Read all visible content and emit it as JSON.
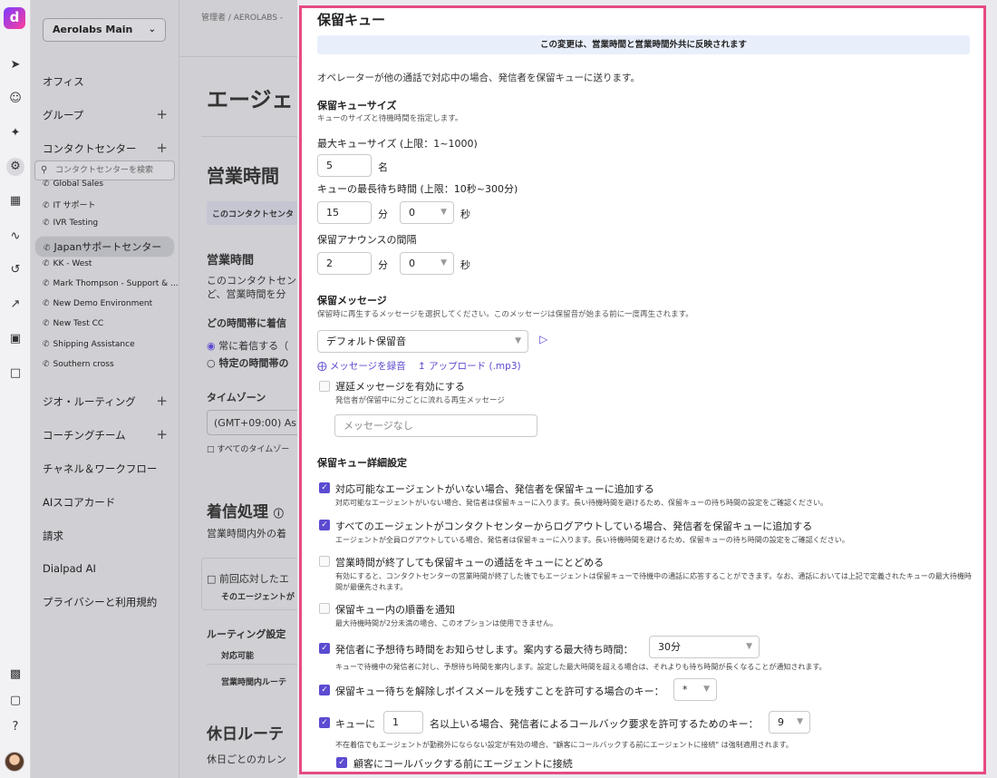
{
  "rail": {
    "logo": "d",
    "icons": [
      "rocket-icon",
      "user-icon",
      "sparkle-icon",
      "gear-icon",
      "clipboard-icon",
      "activity-icon",
      "history-icon",
      "trend-icon",
      "video-icon",
      "cube-icon",
      "dialpad-icon",
      "camera-icon",
      "help-icon",
      "avatar"
    ]
  },
  "sidebar": {
    "workspace": "Aerolabs Main",
    "nav_top": [
      "オフィス",
      "グループ",
      "コンタクトセンター"
    ],
    "search_placeholder": "コンタクトセンターを検索",
    "contact_centers": [
      "Global Sales",
      "IT サポート",
      "IVR Testing",
      "Japanサポートセンター",
      "KK - West",
      "Mark Thompson - Support & ...",
      "New Demo Environment",
      "New Test CC",
      "Shipping Assistance",
      "Southern cross"
    ],
    "selected_index": 3,
    "nav_bottom": [
      "ジオ・ルーティング",
      "コーチングチーム",
      "チャネル＆ワークフロー",
      "AIスコアカード",
      "請求",
      "Dialpad AI",
      "プライバシーと利用規約"
    ]
  },
  "background": {
    "breadcrumb": "管理者 / AEROLABS -",
    "title": "エージェ",
    "hours_title": "営業時間",
    "banner": "このコンタクトセンタ",
    "hours_section": "営業時間",
    "hours_desc1": "このコンタクトセン",
    "hours_desc2": "ど、営業時間を分",
    "which_hours": "どの時間帯に着信",
    "radio1": "常に着信する（",
    "radio2": "特定の時間帯の",
    "timezone_label": "タイムゾーン",
    "timezone_value": "(GMT+09:00) As",
    "all_tz": "すべてのタイムゾー",
    "incoming": "着信処理",
    "incoming_desc": "営業時間内外の着",
    "prev_agent": "前回応対したエ",
    "that_agent": "そのエージェントが",
    "routing": "ルーティング設定",
    "available": "対応可能",
    "in_hours_route": "営業時間内ルーテ",
    "holiday": "休日ルーテ",
    "holiday_desc": "休日ごとのカレン"
  },
  "drawer": {
    "title": "保留キュー",
    "banner": "この変更は、営業時間と営業時間外共に反映されます",
    "description": "オペレーターが他の通話で対応中の場合、発信者を保留キューに送ります。",
    "queue_size": {
      "title": "保留キューサイズ",
      "subtitle": "キューのサイズと待機時間を指定します。",
      "max_label": "最大キューサイズ (上限：1~1000)",
      "max_value": "5",
      "max_unit": "名",
      "wait_label": "キューの最長待ち時間 (上限：10秒~300分)",
      "wait_min": "15",
      "wait_min_unit": "分",
      "wait_sec": "0",
      "wait_sec_unit": "秒",
      "announce_label": "保留アナウンスの間隔",
      "announce_min": "2",
      "announce_min_unit": "分",
      "announce_sec": "0",
      "announce_sec_unit": "秒"
    },
    "message": {
      "title": "保留メッセージ",
      "subtitle": "保留時に再生するメッセージを選択してください。このメッセージは保留音が始まる前に一度再生されます。",
      "select_value": "デフォルト保留音",
      "record_link": "メッセージを録音",
      "upload_link": "アップロード (.mp3)",
      "delay_label": "遅延メッセージを有効にする",
      "delay_desc": "発信者が保留中に分ごとに流れる再生メッセージ",
      "delay_placeholder": "メッセージなし"
    },
    "advanced": {
      "title": "保留キュー詳細設定",
      "opt1_label": "対応可能なエージェントがいない場合、発信者を保留キューに追加する",
      "opt1_desc": "対応可能なエージェントがいない場合、発信者は保留キューに入ります。長い待機時間を避けるため、保留キューの待ち時間の設定をご確認ください。",
      "opt2_label": "すべてのエージェントがコンタクトセンターからログアウトしている場合、発信者を保留キューに追加する",
      "opt2_desc": "エージェントが全員ログアウトしている場合、発信者は保留キューに入ります。長い待機時間を避けるため、保留キューの待ち時間の設定をご確認ください。",
      "opt3_label": "営業時間が終了しても保留キューの通話をキューにとどめる",
      "opt3_desc": "有効にすると、コンタクトセンターの営業時間が終了した後でもエージェントは保留キューで待機中の通話に応答することができます。なお、通話においては上記で定義されたキューの最大待機時間が最優先されます。",
      "opt4_label": "保留キュー内の順番を通知",
      "opt4_desc": "最大待機時間が2分未満の場合、このオプションは使用できません。",
      "opt5_label": "発信者に予想待ち時間をお知らせします。案内する最大待ち時間：",
      "opt5_select": "30分",
      "opt5_desc": "キューで待機中の発信者に対し、予想待ち時間を案内します。設定した最大時間を超える場合は、それよりも待ち時間が長くなることが通知されます。",
      "opt6_label": "保留キュー待ちを解除しボイスメールを残すことを許可する場合のキー：",
      "opt6_select": "*",
      "opt7_prefix": "キューに",
      "opt7_value": "1",
      "opt7_middle": "名以上いる場合、発信者によるコールバック要求を許可するためのキー：",
      "opt7_select": "9",
      "opt7_desc": "不在着信でもエージェントが勤務外にならない設定が有効の場合、\"顧客にコールバックする前にエージェントに接続\" は強制適用されます。",
      "opt8_label": "顧客にコールバックする前にエージェントに接続"
    }
  }
}
